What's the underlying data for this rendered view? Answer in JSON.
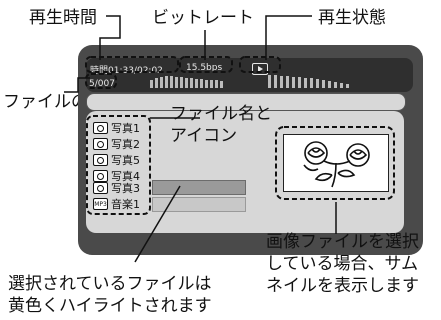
{
  "callouts": {
    "playback_time": "再生時間",
    "bitrate": "ビットレート",
    "playback_state": "再生状態",
    "file_count": "ファイルの数",
    "file_name_icon_line1": "ファイル名と",
    "file_name_icon_line2": "アイコン",
    "thumbnail_line1": "画像ファイルを選択",
    "thumbnail_line2": "している場合、サム",
    "thumbnail_line3": "ネイルを表示します",
    "selected_line1": "選択されているファイルは",
    "selected_line2": "黄色くハイライトされます"
  },
  "screen": {
    "time_text": "時間01:33/02:02",
    "bitrate_text": "15.5bps",
    "count_text": "5/007"
  },
  "files": [
    {
      "icon": "camera-icon",
      "label": "写真1"
    },
    {
      "icon": "camera-icon",
      "label": "写真2"
    },
    {
      "icon": "camera-icon",
      "label": "写真5"
    },
    {
      "icon": "camera-icon",
      "label": "写真4"
    },
    {
      "icon": "camera-icon",
      "label": "写真3",
      "selected": true
    },
    {
      "icon": "mp3-icon",
      "label": "音楽1",
      "icon_text": "MP3"
    }
  ],
  "colors": {
    "device": "#4a4a4a",
    "statusbar": "#2f2f2f",
    "panel": "#d7d7d7",
    "highlight": "#9a9a9a"
  }
}
